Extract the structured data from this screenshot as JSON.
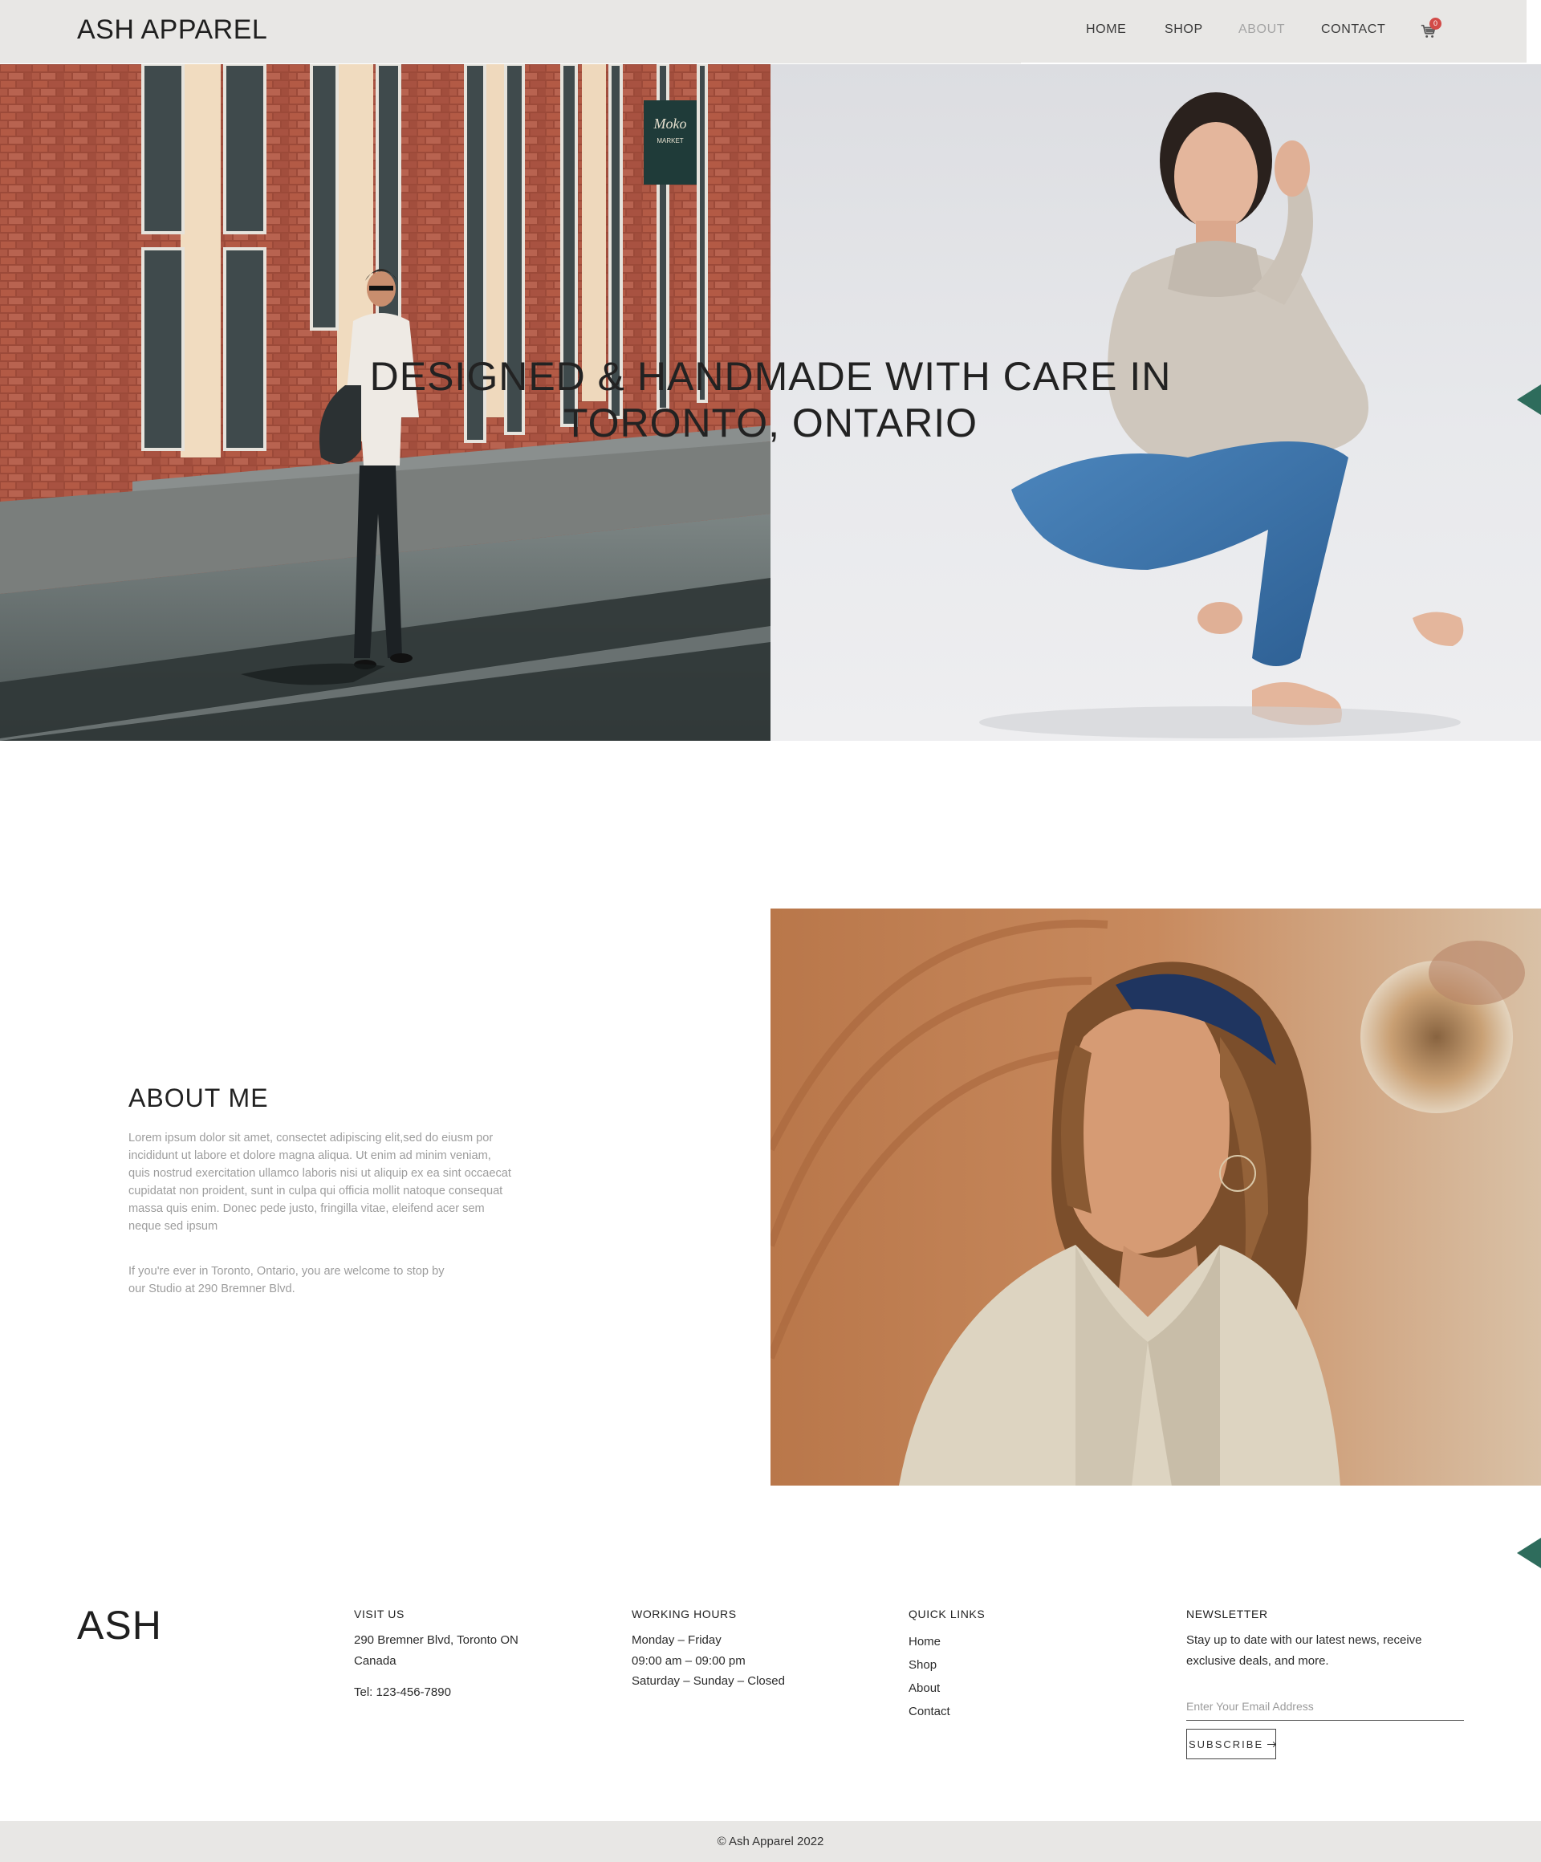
{
  "header": {
    "brand": "ASH APPAREL",
    "nav": [
      {
        "label": "HOME"
      },
      {
        "label": "SHOP"
      },
      {
        "label": "ABOUT",
        "active": true
      },
      {
        "label": "CONTACT"
      }
    ],
    "cart_count": "0",
    "cart_icon": "cart-icon"
  },
  "hero": {
    "title_line1": "DESIGNED & HANDMADE WITH CARE IN",
    "title_line2": "TORONTO, ONTARIO",
    "left_image": "man walking on street",
    "right_image": "woman in knit sweater sitting"
  },
  "about": {
    "title": "ABOUT ME",
    "paragraph1": "Lorem ipsum dolor sit amet, consectet adipiscing elit,sed do eiusm por incididunt ut labore et dolore magna aliqua. Ut enim ad minim veniam, quis nostrud exercitation ullamco laboris nisi ut aliquip ex ea sint occaecat cupidatat non proident, sunt in culpa qui officia mollit natoque consequat massa quis enim. Donec pede justo, fringilla vitae, eleifend acer sem neque sed ipsum",
    "paragraph2": "If you're ever in Toronto, Ontario, you are welcome to stop by our Studio at 290 Bremner Blvd.",
    "image": "woman with headband portrait"
  },
  "footer": {
    "logo": "ASH",
    "visit": {
      "heading": "VISIT US",
      "address_line1": "290 Bremner Blvd, Toronto ON",
      "address_line2": "Canada",
      "tel": "Tel: 123-456-7890"
    },
    "hours": {
      "heading": "WORKING HOURS",
      "line1": "Monday – Friday",
      "line2": "09:00 am – 09:00 pm",
      "line3": "Saturday – Sunday – Closed"
    },
    "links": {
      "heading": "QUICK LINKS",
      "items": [
        "Home",
        "Shop",
        "About",
        "Contact"
      ]
    },
    "newsletter": {
      "heading": "NEWSLETTER",
      "text": "Stay up to date with our latest news, receive exclusive deals, and more.",
      "placeholder": "Enter Your Email Address",
      "button": "SUBSCRIBE"
    }
  },
  "copyright": "© Ash Apparel 2022",
  "colors": {
    "accent": "#2e6c5c",
    "header_bg": "#e8e7e5",
    "badge": "#d24b48"
  }
}
